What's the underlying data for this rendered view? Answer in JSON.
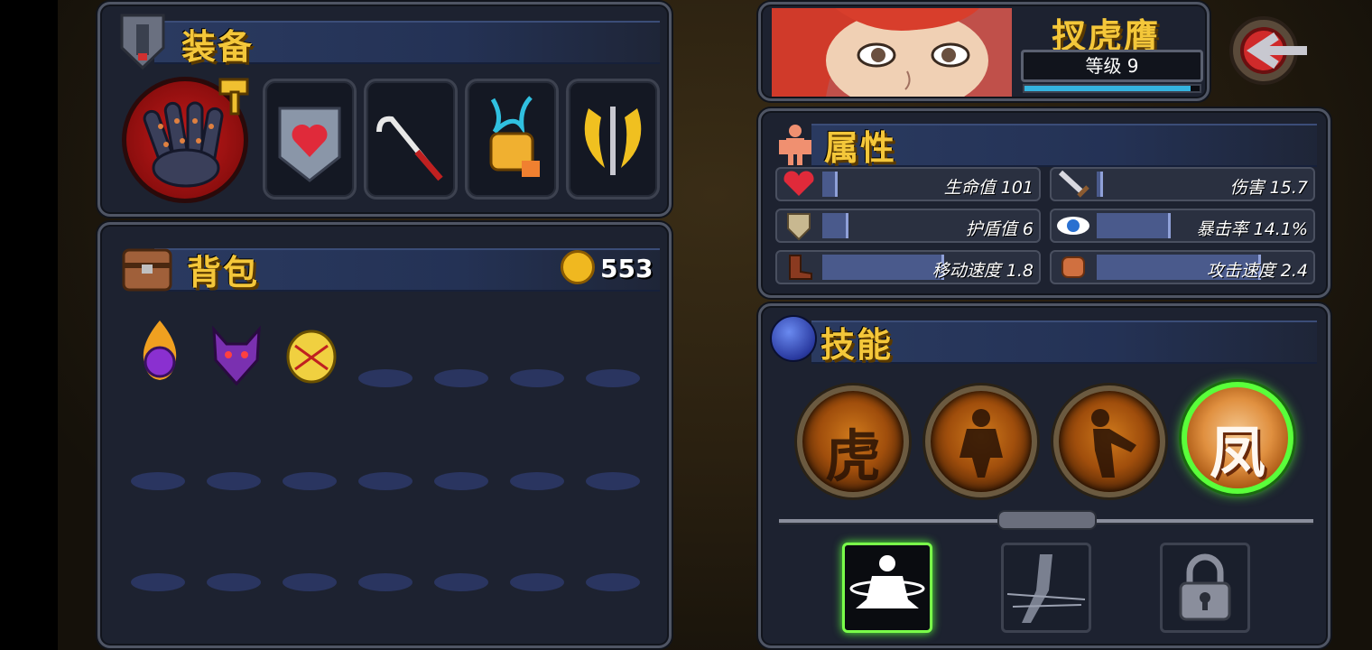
{
  "equipment": {
    "title": "装备"
  },
  "backpack": {
    "title": "背包",
    "gold": "553"
  },
  "character": {
    "name": "扠虎膺",
    "level_label": "等级 9",
    "xp_fraction": 0.95
  },
  "attributes": {
    "title": "属性",
    "stats": [
      {
        "label": "生命值 101",
        "icon": "heart-icon",
        "fill": 0.06
      },
      {
        "label": "伤害 15.7",
        "icon": "sword-icon",
        "fill": 0.01
      },
      {
        "label": "护盾值 6",
        "icon": "shield-icon",
        "fill": 0.11
      },
      {
        "label": "暴击率 14.1%",
        "icon": "eye-icon",
        "fill": 0.34
      },
      {
        "label": "移动速度 1.8",
        "icon": "boot-icon",
        "fill": 0.57
      },
      {
        "label": "攻击速度 2.4",
        "icon": "fist-icon",
        "fill": 0.77
      }
    ]
  },
  "skills": {
    "title": "技能",
    "orbs": [
      {
        "glyph": "虎",
        "active": false
      },
      {
        "glyph": "",
        "active": false
      },
      {
        "glyph": "",
        "active": false
      },
      {
        "glyph": "凤",
        "active": true
      }
    ]
  },
  "colors": {
    "gold": "#f4c73a",
    "panel": "#1d2230",
    "active_green": "#5aff3a",
    "xp_bar": "#34b4e0"
  }
}
